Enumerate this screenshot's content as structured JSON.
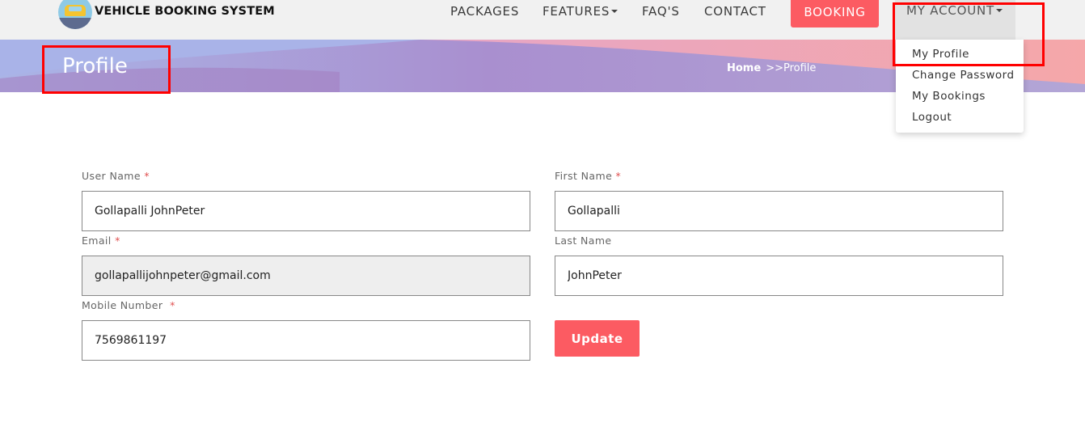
{
  "header": {
    "brand": "VEHICLE BOOKING SYSTEM",
    "logo_icon": "taxi-car-icon",
    "nav": {
      "packages": "PACKAGES",
      "features": "FEATURES",
      "faqs": "FAQ'S",
      "contact": "CONTACT",
      "booking": "BOOKING",
      "my_account": "MY ACCOUNT"
    }
  },
  "account_menu": {
    "items": [
      "My Profile",
      "Change Password",
      "My Bookings",
      "Logout"
    ]
  },
  "banner": {
    "title": "Profile",
    "breadcrumb_home": "Home",
    "breadcrumb_current": ">>Profile"
  },
  "form": {
    "username": {
      "label": "User Name",
      "required": "*",
      "value": "Gollapalli JohnPeter"
    },
    "firstname": {
      "label": "First Name",
      "required": "*",
      "value": "Gollapalli"
    },
    "email": {
      "label": "Email",
      "required": "*",
      "value": "gollapallijohnpeter@gmail.com"
    },
    "lastname": {
      "label": "Last Name",
      "value": "JohnPeter"
    },
    "mobile": {
      "label": "Mobile Number",
      "required": "*",
      "value": "7569861197"
    },
    "update_label": "Update"
  },
  "colors": {
    "accent": "#fc5b62",
    "navbar_bg": "#f1f1f1",
    "banner_purple": "#a78bc6",
    "annotation": "#ff0000"
  }
}
